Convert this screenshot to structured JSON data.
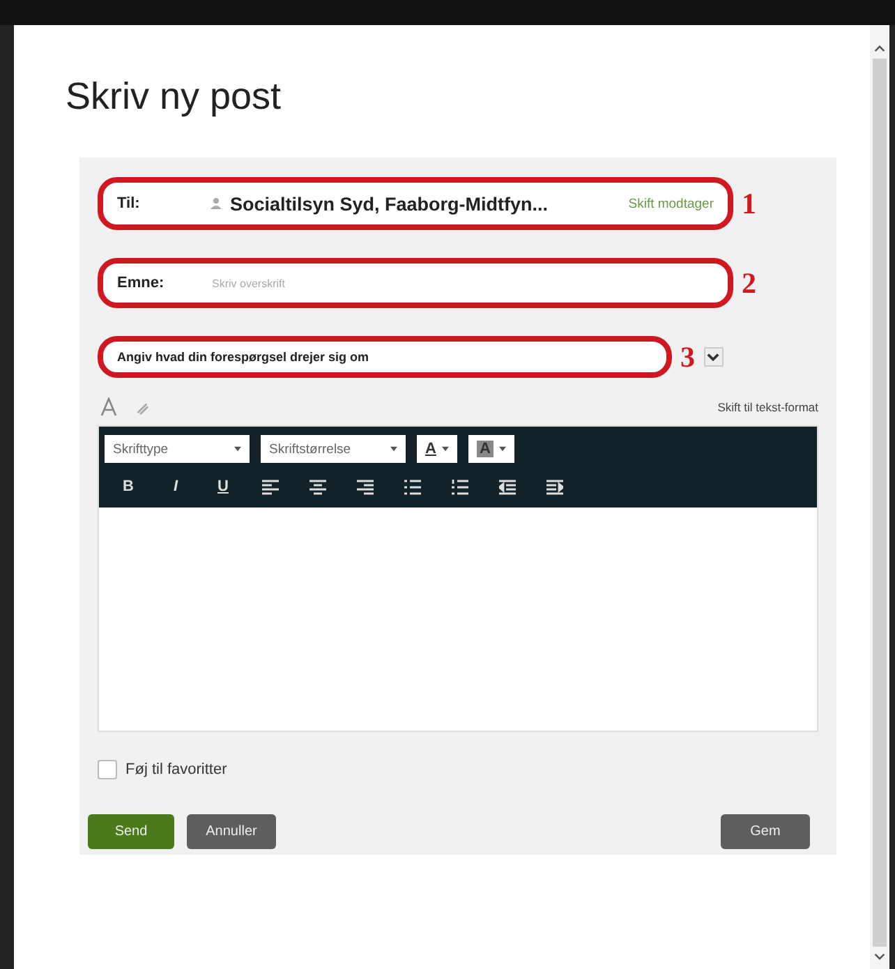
{
  "dialog": {
    "title": "Skriv ny post"
  },
  "recipient": {
    "label": "Til:",
    "value": "Socialtilsyn Syd, Faaborg-Midtfyn...",
    "link": "Skift modtager",
    "annotation": "1"
  },
  "subject": {
    "label": "Emne:",
    "placeholder": "Skriv overskrift",
    "annotation": "2"
  },
  "topic": {
    "value": "Angiv hvad din forespørgsel drejer sig om",
    "annotation": "3"
  },
  "editor": {
    "switch_link": "Skift til tekst-format",
    "dropdowns": [
      {
        "label": "Skrifttype",
        "kind": "select"
      },
      {
        "label": "Skriftstørrelse",
        "kind": "select"
      },
      {
        "label": "A",
        "kind": "color"
      },
      {
        "label": "A",
        "kind": "highlight"
      }
    ],
    "buttons": [
      {
        "label": "B",
        "kind": "bold"
      },
      {
        "label": "I",
        "kind": "italic"
      },
      {
        "label": "U",
        "kind": "underline"
      },
      {
        "kind": "align-left"
      },
      {
        "kind": "align-center"
      },
      {
        "kind": "align-right"
      },
      {
        "kind": "bullet-list"
      },
      {
        "kind": "number-list"
      },
      {
        "kind": "outdent"
      },
      {
        "kind": "indent"
      }
    ]
  },
  "favorite": {
    "label": "Føj til favoritter",
    "checked": false
  },
  "actions": [
    {
      "label": "Send",
      "kind": "primary"
    },
    {
      "label": "Annuller",
      "kind": "secondary"
    },
    {
      "label": "Gem",
      "kind": "save"
    }
  ]
}
